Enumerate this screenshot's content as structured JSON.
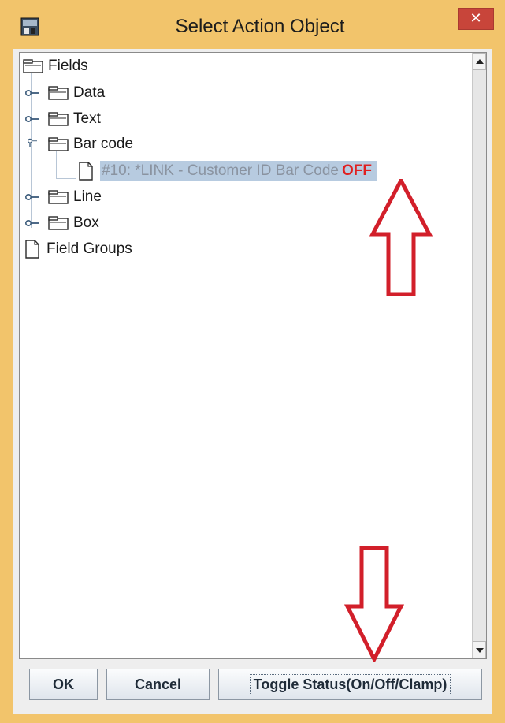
{
  "window": {
    "title": "Select Action Object",
    "close_glyph": "✕"
  },
  "tree": {
    "root_label": "Fields",
    "folders": [
      {
        "label": "Data",
        "expanded": false
      },
      {
        "label": "Text",
        "expanded": false
      },
      {
        "label": "Bar code",
        "expanded": true
      },
      {
        "label": "Line",
        "expanded": false
      },
      {
        "label": "Box",
        "expanded": false
      }
    ],
    "selected_item": {
      "label": "#10: *LINK - Customer ID Bar Code",
      "status": "OFF"
    },
    "field_groups_label": "Field Groups"
  },
  "buttons": {
    "ok": "OK",
    "cancel": "Cancel",
    "toggle": "Toggle Status(On/Off/Clamp)"
  },
  "colors": {
    "title_bar": "#f2c46b",
    "close_button": "#c8453a",
    "selection": "#b7cbe0",
    "status_off": "#e02020",
    "annotation_arrow": "#d21f2a"
  },
  "icons": {
    "app": "app-icon",
    "folder": "folder-icon",
    "file": "file-icon",
    "close": "close-icon"
  }
}
